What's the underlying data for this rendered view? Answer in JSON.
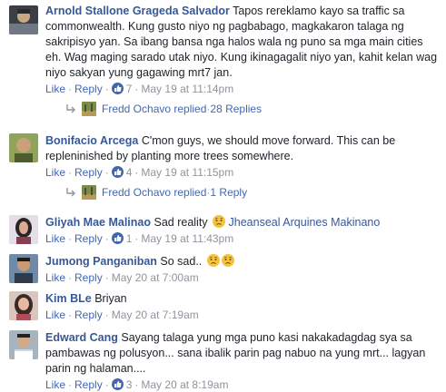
{
  "comments": [
    {
      "author": "Arnold Stallone Grageda Salvador",
      "text": "Tapos rereklamo kayo sa traffic sa commonwealth. Kung gusto niyo ng pagbabago, magkakaron talaga ng sakripisyo yan. Sa ibang bansa nga halos wala ng puno sa mga main cities eh. Wag maging sarado utak niyo. Kung ikinagagalit niyo yan, kahit kelan wag niyo sakyan yung gagawing mrt7 jan.",
      "like_label": "Like",
      "reply_label": "Reply",
      "reaction_count": "7",
      "timestamp": "May 19 at 11:14pm",
      "replies": {
        "replier": "Fredd Ochavo replied",
        "count_label": "28 Replies"
      }
    },
    {
      "author": "Bonifacio Arcega",
      "text": "C'mon guys, we should move forward. This can be repleninished by planting more trees somewhere.",
      "like_label": "Like",
      "reply_label": "Reply",
      "reaction_count": "4",
      "timestamp": "May 19 at 11:15pm",
      "replies": {
        "replier": "Fredd Ochavo replied",
        "count_label": "1 Reply"
      }
    },
    {
      "author": "Gliyah Mae Malinao",
      "text": "Sad reality",
      "mention": "Jheanseal Arquines Makinano",
      "emoji": "sad-face",
      "like_label": "Like",
      "reply_label": "Reply",
      "reaction_count": "1",
      "timestamp": "May 19 at 11:43pm"
    },
    {
      "author": "Jumong Panganiban",
      "text": "So sad..",
      "emoji": "sad-face-x2",
      "like_label": "Like",
      "reply_label": "Reply",
      "timestamp": "May 20 at 7:00am"
    },
    {
      "author": "Kim BLe",
      "text": "Briyan",
      "like_label": "Like",
      "reply_label": "Reply",
      "timestamp": "May 20 at 7:19am"
    },
    {
      "author": "Edward Cang",
      "text": "Sayang talaga yung mga puno kasi nakakadagdag sya sa pambawas ng polusyon... sana ibalik parin pag nabuo na yung mrt... lagyan parin ng halaman....",
      "like_label": "Like",
      "reply_label": "Reply",
      "reaction_count": "3",
      "timestamp": "May 20 at 8:19am"
    }
  ],
  "separator": "·",
  "colors": {
    "link": "#4267b2",
    "name": "#365899",
    "meta": "#90949c",
    "text": "#1d2129",
    "emoji": "#f5c33b"
  }
}
